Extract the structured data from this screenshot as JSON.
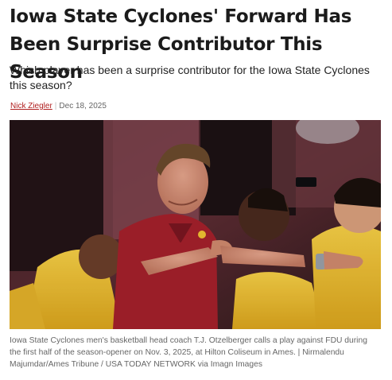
{
  "article": {
    "headline": "Iowa State Cyclones' Forward Has Been Surprise Contributor This Season",
    "subheadline": "Which player has been a surprise contributor for the Iowa State Cyclones this season?",
    "author": "Nick Ziegler",
    "separator": "|",
    "date": "Dec 18, 2025"
  },
  "image": {
    "caption": "Iowa State Cyclones men's basketball head coach T.J. Otzelberger calls a play against FDU during the first half of the season-opener on Nov. 3, 2025, at Hilton Coliseum in Ames. | Nirmalendu Majumdar/Ames Tribune / USA TODAY NETWORK via Imagn Images"
  },
  "colors": {
    "author_link": "#b01e1e",
    "cardinal": "#a4202b",
    "gold": "#f1c232"
  }
}
